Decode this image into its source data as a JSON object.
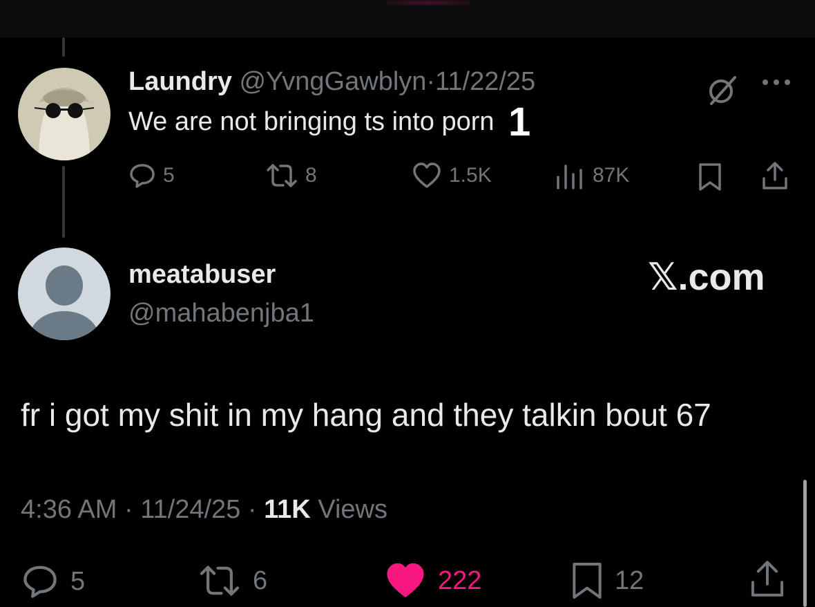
{
  "colors": {
    "background": "#000000",
    "text": "#e7e9ea",
    "muted": "#71767b",
    "like_active": "#f91880"
  },
  "reply_tweet": {
    "display_name": "Laundry",
    "handle": "@YvngGawblyn",
    "separator": "·",
    "date": "11/22/25",
    "text": "We are not bringing ts into porn",
    "overlay_number": "1",
    "actions": {
      "replies": "5",
      "reposts": "8",
      "likes": "1.5K",
      "views": "87K"
    },
    "icons": [
      "grok-icon",
      "more-icon",
      "reply-icon",
      "repost-icon",
      "like-icon",
      "views-icon",
      "bookmark-icon",
      "share-icon"
    ]
  },
  "main_tweet": {
    "display_name": "meatabuser",
    "handle": "@mahabenjba1",
    "watermark": "𝕏.com",
    "text": "fr i got my shit in my hang and they talkin bout 67",
    "time": "4:36 AM",
    "date": "11/24/25",
    "separator": "·",
    "views_count": "11K",
    "views_label": "Views",
    "actions": {
      "replies": "5",
      "reposts": "6",
      "likes": "222",
      "bookmarks": "12"
    },
    "liked": true
  }
}
